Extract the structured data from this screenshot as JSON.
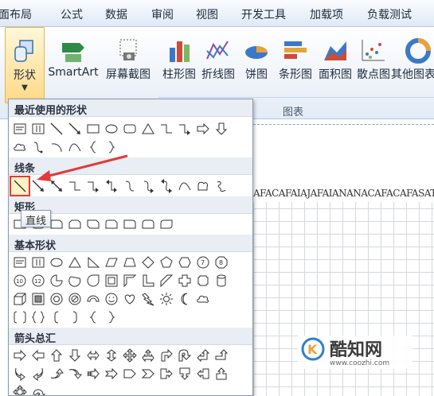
{
  "tabs": [
    "面布局",
    "公式",
    "数据",
    "审阅",
    "视图",
    "开发工具",
    "加载项",
    "负载测试"
  ],
  "ribbon": {
    "shapes_label": "形状",
    "smartart_label": "SmartArt",
    "screenshot_label": "屏幕截图",
    "charts": [
      {
        "label": "柱形图",
        "icon": "column-chart-icon"
      },
      {
        "label": "折线图",
        "icon": "line-chart-icon"
      },
      {
        "label": "饼图",
        "icon": "pie-chart-icon"
      },
      {
        "label": "条形图",
        "icon": "bar-chart-icon"
      },
      {
        "label": "面积图",
        "icon": "area-chart-icon"
      },
      {
        "label": "散点图",
        "icon": "scatter-chart-icon"
      },
      {
        "label": "其他图表",
        "icon": "other-chart-icon"
      }
    ],
    "chart_group_label": "图表"
  },
  "gallery": {
    "sections": [
      {
        "title": "最近使用的形状"
      },
      {
        "title": "线条"
      },
      {
        "title": "矩形"
      },
      {
        "title": "基本形状"
      },
      {
        "title": "箭头总汇"
      }
    ],
    "tooltip": "直线"
  },
  "sheet": {
    "ruler_text": "AFACAFAIAJAFAIANANACAFACAFASAT"
  },
  "watermark": {
    "title": "酷知网",
    "url": "www.coozhi.com"
  },
  "colors": {
    "selection_outline": "#e23a3a",
    "annotation_arrow": "#e23a3a",
    "shapes_button_active": "#ffd987"
  }
}
